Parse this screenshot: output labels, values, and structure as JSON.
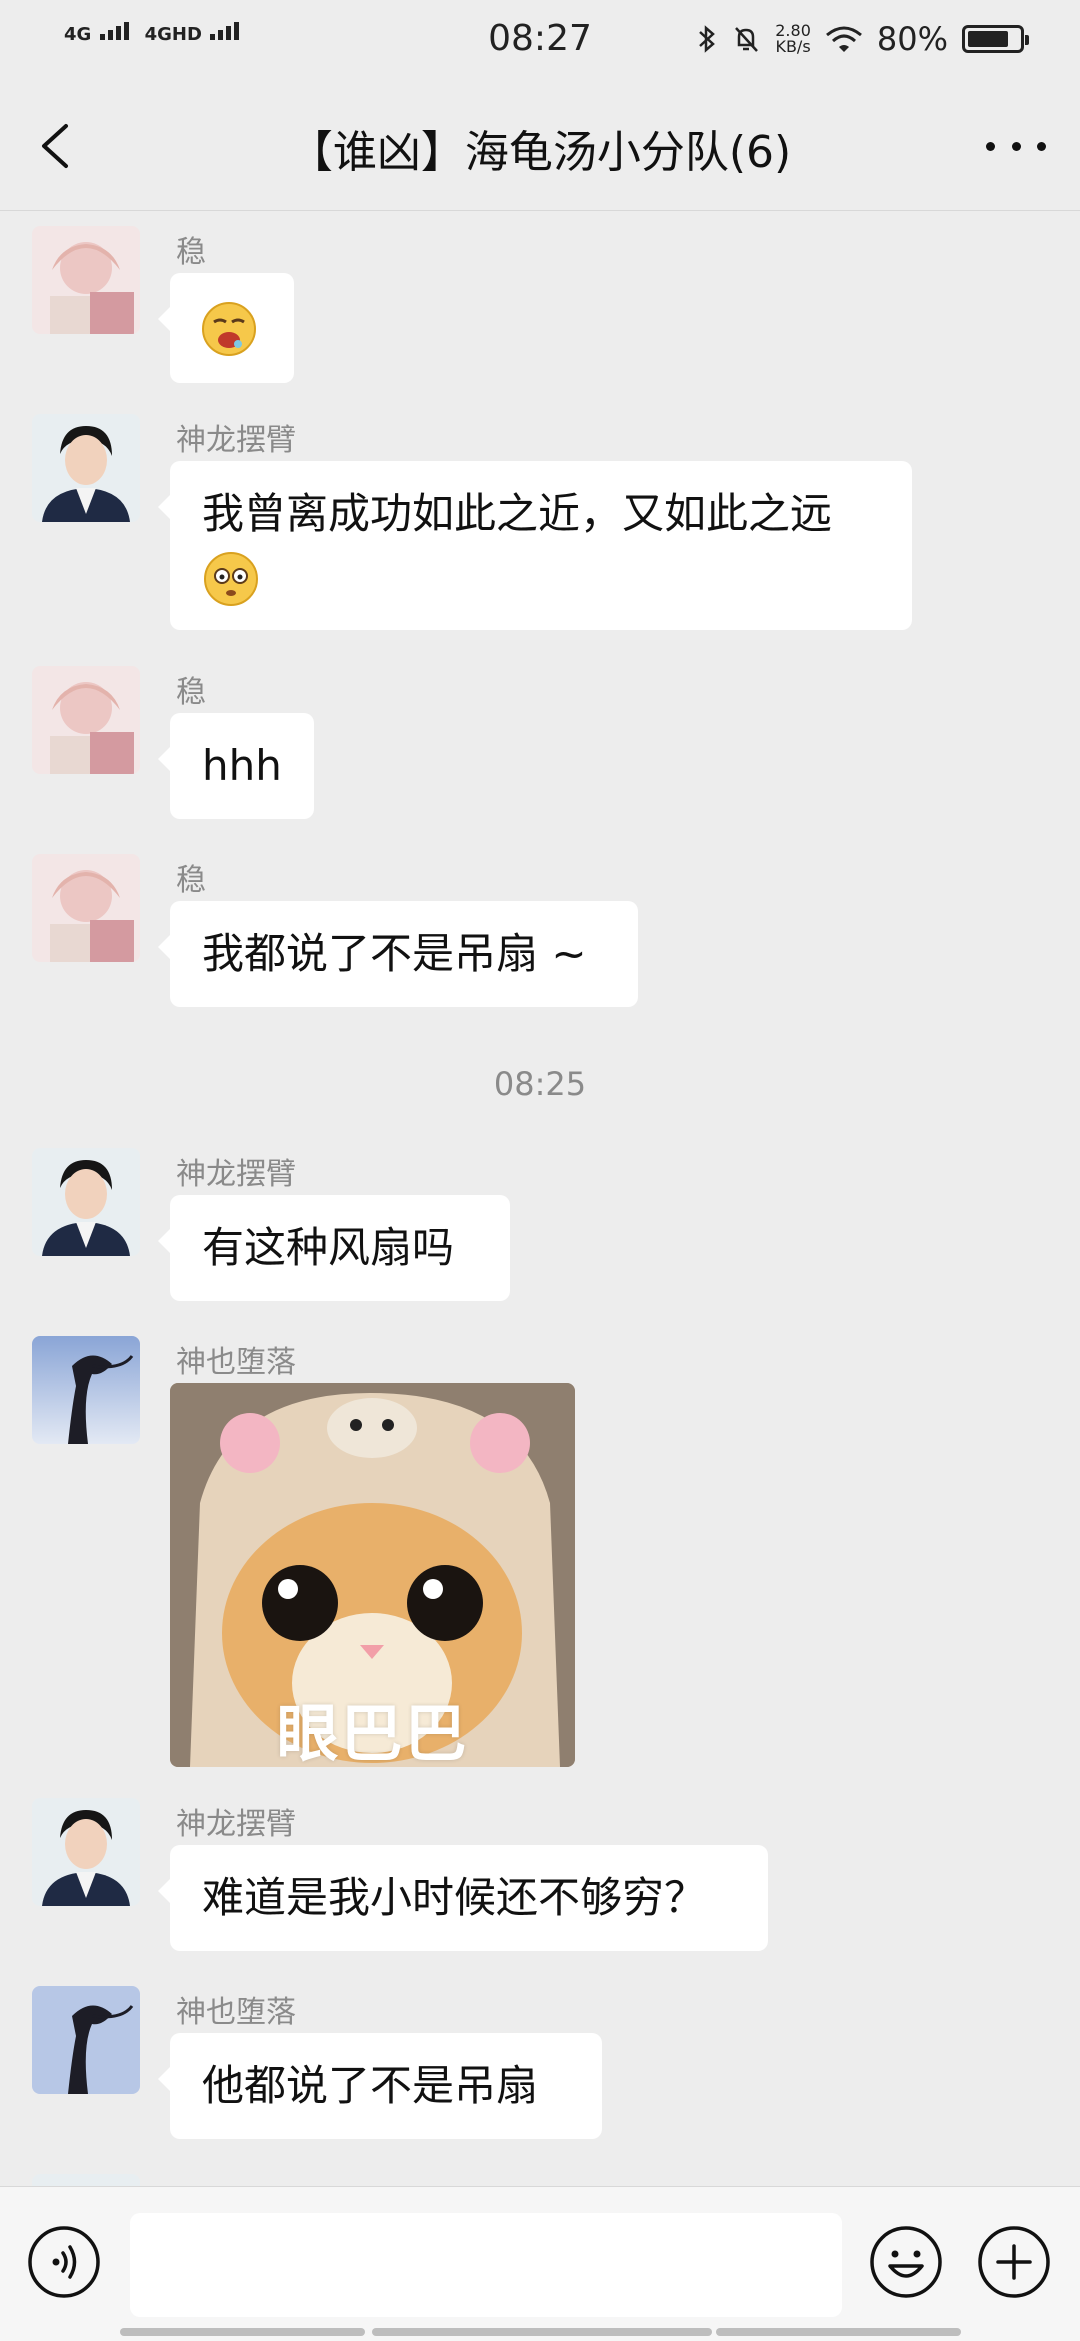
{
  "status_bar": {
    "network_1": "4G",
    "network_2": "4GHD",
    "time": "08:27",
    "speed_value": "2.80",
    "speed_unit": "KB/s",
    "battery_percent_label": "80%",
    "battery_level": 0.8
  },
  "header": {
    "title": "【谁凶】海龟汤小分队(6)"
  },
  "messages": [
    {
      "sender": "稳",
      "text": "",
      "emoji": "drooling-face-emoji"
    },
    {
      "sender": "神龙摆臂",
      "text": "我曾离成功如此之近，又如此之远",
      "emoji": "flushed-face-emoji"
    },
    {
      "sender": "稳",
      "text": "hhh"
    },
    {
      "sender": "稳",
      "text": "我都说了不是吊扇 ~"
    },
    {
      "sender": "神龙摆臂",
      "text": "有这种风扇吗"
    },
    {
      "sender": "神也堕落",
      "sticker_caption": "眼巴巴"
    },
    {
      "sender": "神龙摆臂",
      "text": "难道是我小时候还不够穷？"
    },
    {
      "sender": "神也堕落",
      "text": "他都说了不是吊扇"
    }
  ],
  "time_separator": "08:25",
  "input_bar": {
    "voice_icon": "voice-icon",
    "emoji_icon": "emoji-icon",
    "plus_icon": "plus-icon",
    "input_value": ""
  },
  "colors": {
    "background": "#ededed",
    "bubble": "#ffffff",
    "sender_text": "#8a8a8a"
  }
}
